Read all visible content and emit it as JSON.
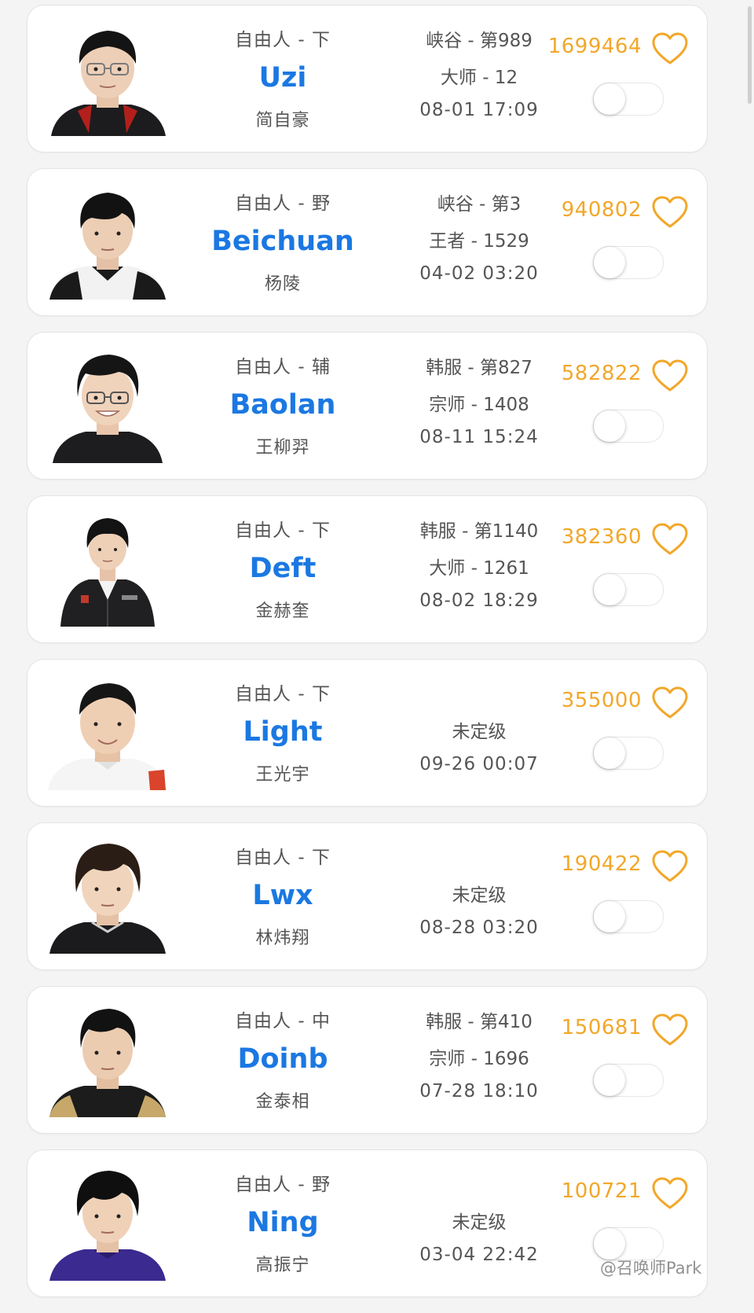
{
  "players": [
    {
      "status": "自由人 - 下",
      "name": "Uzi",
      "real_name": "简自豪",
      "server_line": "峡谷 - 第989",
      "tier_line": "大师 - 12",
      "date": "08-01 17:09",
      "likes": "1699464"
    },
    {
      "status": "自由人 - 野",
      "name": "Beichuan",
      "real_name": "杨陵",
      "server_line": "峡谷 - 第3",
      "tier_line": "王者 - 1529",
      "date": "04-02 03:20",
      "likes": "940802"
    },
    {
      "status": "自由人 - 辅",
      "name": "Baolan",
      "real_name": "王柳羿",
      "server_line": "韩服 - 第827",
      "tier_line": "宗师 - 1408",
      "date": "08-11 15:24",
      "likes": "582822"
    },
    {
      "status": "自由人 - 下",
      "name": "Deft",
      "real_name": "金赫奎",
      "server_line": "韩服 - 第1140",
      "tier_line": "大师 - 1261",
      "date": "08-02 18:29",
      "likes": "382360"
    },
    {
      "status": "自由人 - 下",
      "name": "Light",
      "real_name": "王光宇",
      "server_line": "",
      "tier_line": "未定级",
      "date": "09-26 00:07",
      "likes": "355000"
    },
    {
      "status": "自由人 - 下",
      "name": "Lwx",
      "real_name": "林炜翔",
      "server_line": "",
      "tier_line": "未定级",
      "date": "08-28 03:20",
      "likes": "190422"
    },
    {
      "status": "自由人 - 中",
      "name": "Doinb",
      "real_name": "金泰相",
      "server_line": "韩服 - 第410",
      "tier_line": "宗师 - 1696",
      "date": "07-28 18:10",
      "likes": "150681"
    },
    {
      "status": "自由人 - 野",
      "name": "Ning",
      "real_name": "高振宁",
      "server_line": "",
      "tier_line": "未定级",
      "date": "03-04 22:42",
      "likes": "100721"
    }
  ],
  "watermark": "@召唤师Park",
  "colors": {
    "name_blue": "#1b78e2",
    "likes_orange": "#f2a72a",
    "text_gray": "#555555",
    "page_bg": "#f4f4f5"
  }
}
